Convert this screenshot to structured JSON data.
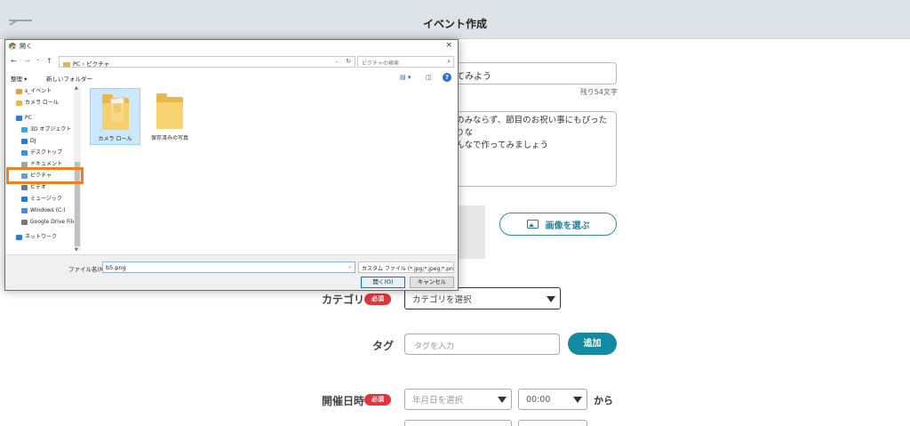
{
  "header": {
    "title": "イベント作成",
    "back_icon": "back-arrow-icon"
  },
  "form": {
    "title_value": "てみよう",
    "remaining": "残り54文字",
    "description_lines": [
      "のみならず、節目のお祝い事にもぴったりな",
      "んなで作ってみましょう"
    ],
    "choose_image_label": "画像を選ぶ",
    "category_label": "カテゴリ",
    "required_badge": "必須",
    "category_select": "カテゴリを選択",
    "tag_label": "タグ",
    "tag_placeholder": "タグを入力",
    "add_button": "追加",
    "date_label": "開催日時",
    "date_select": "年月日を選択",
    "time_select": "00:00",
    "from_label": "から"
  },
  "dialog": {
    "title": "開く",
    "close": "×",
    "nav": {
      "back": "←",
      "forward": "→",
      "dropdown": "⌄",
      "up": "↑"
    },
    "address": "PC › ピクチャ",
    "address_dropdown": "⌄",
    "refresh": "↻",
    "search_placeholder": "ピクチャの検索",
    "search_icon": "⌕",
    "toolbar": {
      "organize": "整理 ▾",
      "new_folder": "新しいフォルダー",
      "view_icon": "▤ ▾",
      "pane_icon": "◫",
      "help_icon": "?"
    },
    "sidebar": [
      {
        "label": "s_イベント",
        "icon": "user-folder",
        "color": "#d9a441"
      },
      {
        "label": "カメラ ロール",
        "icon": "folder",
        "color": "#e9b84a"
      },
      {
        "label": "PC",
        "icon": "computer",
        "color": "#2b7ad6"
      },
      {
        "label": "3D オブジェクト",
        "icon": "cube",
        "color": "#3ca4e0"
      },
      {
        "label": "DJ",
        "icon": "download",
        "color": "#2b7ad6"
      },
      {
        "label": "デスクトップ",
        "icon": "desktop",
        "color": "#3b8ee0"
      },
      {
        "label": "ドキュメント",
        "icon": "document",
        "color": "#9aa5b1"
      },
      {
        "label": "ピクチャ",
        "icon": "pictures",
        "color": "#5fa1d8"
      },
      {
        "label": "ビデオ",
        "icon": "video",
        "color": "#6a7a8a"
      },
      {
        "label": "ミュージック",
        "icon": "music",
        "color": "#2b7ad6"
      },
      {
        "label": "Windows (C:)",
        "icon": "drive",
        "color": "#4b8bd0"
      },
      {
        "label": "Google Drive File",
        "icon": "drive",
        "color": "#777"
      },
      {
        "label": "ネットワーク",
        "icon": "network",
        "color": "#2b7ad6"
      }
    ],
    "scroll": {
      "up": "▲",
      "down": "▼"
    },
    "files": [
      {
        "label": "カメラ ロール",
        "selected": true
      },
      {
        "label": "保存済みの写真",
        "selected": false
      }
    ],
    "filename_label": "ファイル名(N):",
    "filename_value": "b5.png",
    "filename_dropdown": "⌄",
    "filetype": "カスタム ファイル (*.jpg;*.jpeg;*.pn",
    "open_button": "開く(O)",
    "cancel_button": "キャンセル"
  },
  "colors": {
    "accent": "#148aa0",
    "required": "#e0353d",
    "highlight": "#f07f1f",
    "header_bg": "#dde3e6"
  }
}
